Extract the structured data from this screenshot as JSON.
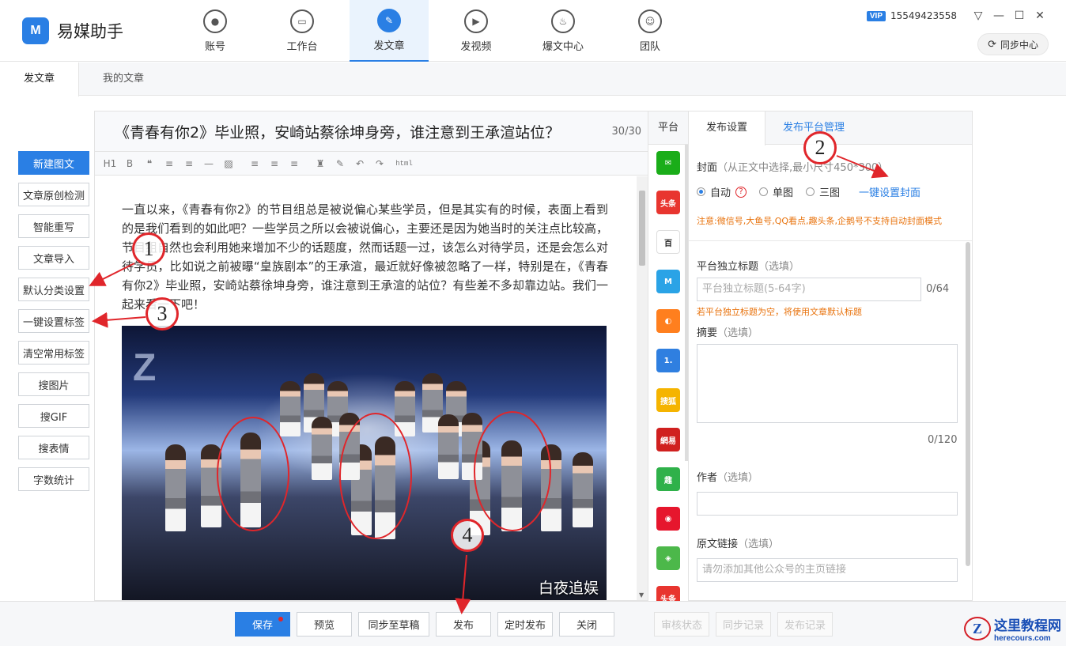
{
  "app": {
    "name": "易媒助手",
    "logo_mark": "M",
    "accent_color": "#2a7fe4"
  },
  "nav": [
    {
      "label": "账号",
      "icon": "user-icon",
      "glyph": "●",
      "active": false
    },
    {
      "label": "工作台",
      "icon": "monitor-icon",
      "glyph": "▭",
      "active": false
    },
    {
      "label": "发文章",
      "icon": "feather-icon",
      "glyph": "✎",
      "active": true
    },
    {
      "label": "发视频",
      "icon": "play-icon",
      "glyph": "▶",
      "active": false
    },
    {
      "label": "爆文中心",
      "icon": "flame-icon",
      "glyph": "♨",
      "active": false
    },
    {
      "label": "团队",
      "icon": "team-icon",
      "glyph": "☺",
      "active": false
    }
  ],
  "user": {
    "vip_badge": "VIP",
    "phone": "15549423558",
    "sync_center": "同步中心",
    "controls": {
      "dropdown": "▽",
      "minimize": "—",
      "maximize": "☐",
      "close": "✕"
    }
  },
  "subtabs": [
    {
      "label": "发文章",
      "active": true
    },
    {
      "label": "我的文章",
      "active": false
    }
  ],
  "tools": [
    {
      "label": "新建图文",
      "primary": true
    },
    {
      "label": "文章原创检测"
    },
    {
      "label": "智能重写"
    },
    {
      "label": "文章导入"
    },
    {
      "label": "默认分类设置"
    },
    {
      "label": "一键设置标签"
    },
    {
      "label": "清空常用标签"
    },
    {
      "label": "搜图片"
    },
    {
      "label": "搜GIF"
    },
    {
      "label": "搜表情"
    },
    {
      "label": "字数统计"
    }
  ],
  "editor": {
    "title": "《青春有你2》毕业照，安崎站蔡徐坤身旁，谁注意到王承渲站位？",
    "title_count": "30/30",
    "toolbar": [
      "H1",
      "B",
      "❝",
      "≡",
      "≡",
      "—",
      "▨",
      "≡",
      "≡",
      "≡",
      "♜",
      "✎",
      "↶",
      "↷",
      "html"
    ],
    "body": "一直以来，《青春有你2》的节目组总是被说偏心某些学员，但是其实有的时候，表面上看到的是我们看到的如此吧？一些学员之所以会被说偏心，主要还是因为她当时的关注点比较高，节目组自然也会利用她来增加不少的话题度，然而话题一过，该怎么对待学员，还是会怎么对待学员，比如说之前被曝“皇族剧本”的王承渲，最近就好像被忽略了一样，特别是在，《青春有你2》毕业照，安崎站蔡徐坤身旁，谁注意到王承渲的站位？有些差不多却靠边站。我们一起来看一下吧！",
    "photo_watermark": "白夜追娱"
  },
  "platforms": {
    "header": "平台",
    "items": [
      {
        "name": "wechat-icon",
        "glyph": "✉",
        "color": "#1aad19"
      },
      {
        "name": "toutiao-icon",
        "glyph": "头条",
        "color": "#e8352f"
      },
      {
        "name": "baijia-icon",
        "glyph": "百",
        "color": "#ffffff"
      },
      {
        "name": "yidian-icon",
        "glyph": "M",
        "color": "#2aa3e6"
      },
      {
        "name": "dayu-icon",
        "glyph": "◐",
        "color": "#ff7f1e"
      },
      {
        "name": "yidianzixun-icon",
        "glyph": "1.",
        "color": "#2f7fe0"
      },
      {
        "name": "sohu-icon",
        "glyph": "搜狐",
        "color": "#f5b400"
      },
      {
        "name": "netease-icon",
        "glyph": "網易",
        "color": "#d0201f"
      },
      {
        "name": "qutoutiao-icon",
        "glyph": "趣",
        "color": "#2fb14a"
      },
      {
        "name": "weibo-icon",
        "glyph": "◉",
        "color": "#e6162d"
      },
      {
        "name": "aiqiyi-icon",
        "glyph": "◈",
        "color": "#4cb84a"
      },
      {
        "name": "toutiao2-icon",
        "glyph": "头条",
        "color": "#e8352f"
      }
    ]
  },
  "settings": {
    "tabs": [
      {
        "label": "发布设置",
        "active": true
      },
      {
        "label": "发布平台管理",
        "active": false
      }
    ],
    "cover_label": "封面",
    "cover_hint": "（从正文中选择,最小尺寸450*300）",
    "cover_options": [
      {
        "label": "自动",
        "checked": true
      },
      {
        "label": "单图",
        "checked": false
      },
      {
        "label": "三图",
        "checked": false
      }
    ],
    "cover_link": "一键设置封面",
    "cover_note": "注意:微信号,大鱼号,QQ看点,趣头条,企鹅号不支持自动封面模式",
    "title_label": "平台独立标题",
    "optional": "（选填）",
    "title_placeholder": "平台独立标题(5-64字)",
    "title_count": "0/64",
    "title_note": "若平台独立标题为空，将使用文章默认标题",
    "summary_label": "摘要",
    "summary_count": "0/120",
    "author_label": "作者",
    "link_label": "原文链接",
    "link_placeholder": "请勿添加其他公众号的主页链接"
  },
  "bottom": {
    "save": "保存",
    "preview": "预览",
    "sync_draft": "同步至草稿",
    "publish": "发布",
    "schedule": "定时发布",
    "close": "关闭",
    "review_status": "审核状态",
    "sync_record": "同步记录",
    "publish_record": "发布记录"
  },
  "corner_logo": {
    "mark": "Z",
    "name": "这里教程网",
    "domain": "herecours.com"
  },
  "annotations": [
    "1",
    "2",
    "3",
    "4"
  ]
}
